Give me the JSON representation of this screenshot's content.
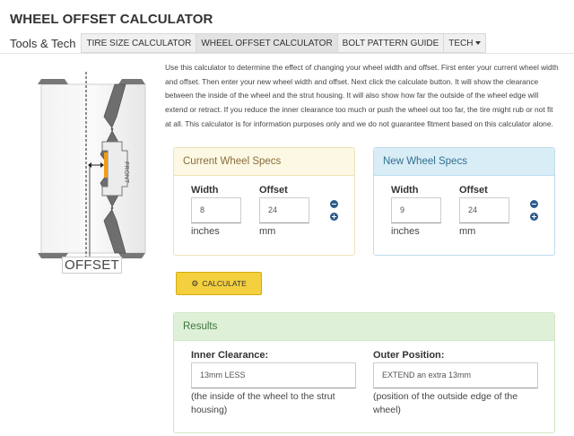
{
  "page": {
    "title": "WHEEL OFFSET CALCULATOR"
  },
  "nav": {
    "brand": "Tools & Tech",
    "tabs": [
      "TIRE SIZE CALCULATOR",
      "WHEEL OFFSET CALCULATOR",
      "BOLT PATTERN GUIDE",
      "TECH"
    ]
  },
  "diagram": {
    "offset_label": "OFFSET",
    "front_label": "FRONT"
  },
  "intro": "Use this calculator to determine the effect of changing your wheel width and offset. First enter your current wheel width and offset. Then enter your new wheel width and offset. Next click the calculate button. It will show the clearance between the inside of the wheel and the strut housing. It will also show how far the outside of the wheel edge will extend or retract. If you reduce the inner clearance too much or push the wheel out too far, the tire might rub or not fit at all. This calculator is for information purposes only and we do not guarantee fitment based on this calculator alone.",
  "current": {
    "heading": "Current Wheel Specs",
    "width_label": "Width",
    "width_value": "8",
    "width_unit": "inches",
    "offset_label": "Offset",
    "offset_value": "24",
    "offset_unit": "mm"
  },
  "new": {
    "heading": "New Wheel Specs",
    "width_label": "Width",
    "width_value": "9",
    "width_unit": "inches",
    "offset_label": "Offset",
    "offset_value": "24",
    "offset_unit": "mm"
  },
  "calculate_label": "CALCULATE",
  "results": {
    "heading": "Results",
    "inner_label": "Inner Clearance:",
    "inner_value": "13mm LESS",
    "inner_note": "(the inside of the wheel to the strut housing)",
    "outer_label": "Outer Position:",
    "outer_value": "EXTEND an extra 13mm",
    "outer_note": "(position of the outside edge of the wheel)"
  },
  "colors": {
    "button": "#f4d03f",
    "hub_accent": "#f39c12",
    "stepper": "#2b5b8a"
  },
  "icons": {
    "stepper_minus": "minus-circle-icon",
    "stepper_plus": "plus-circle-icon",
    "calculate": "gear-icon"
  }
}
